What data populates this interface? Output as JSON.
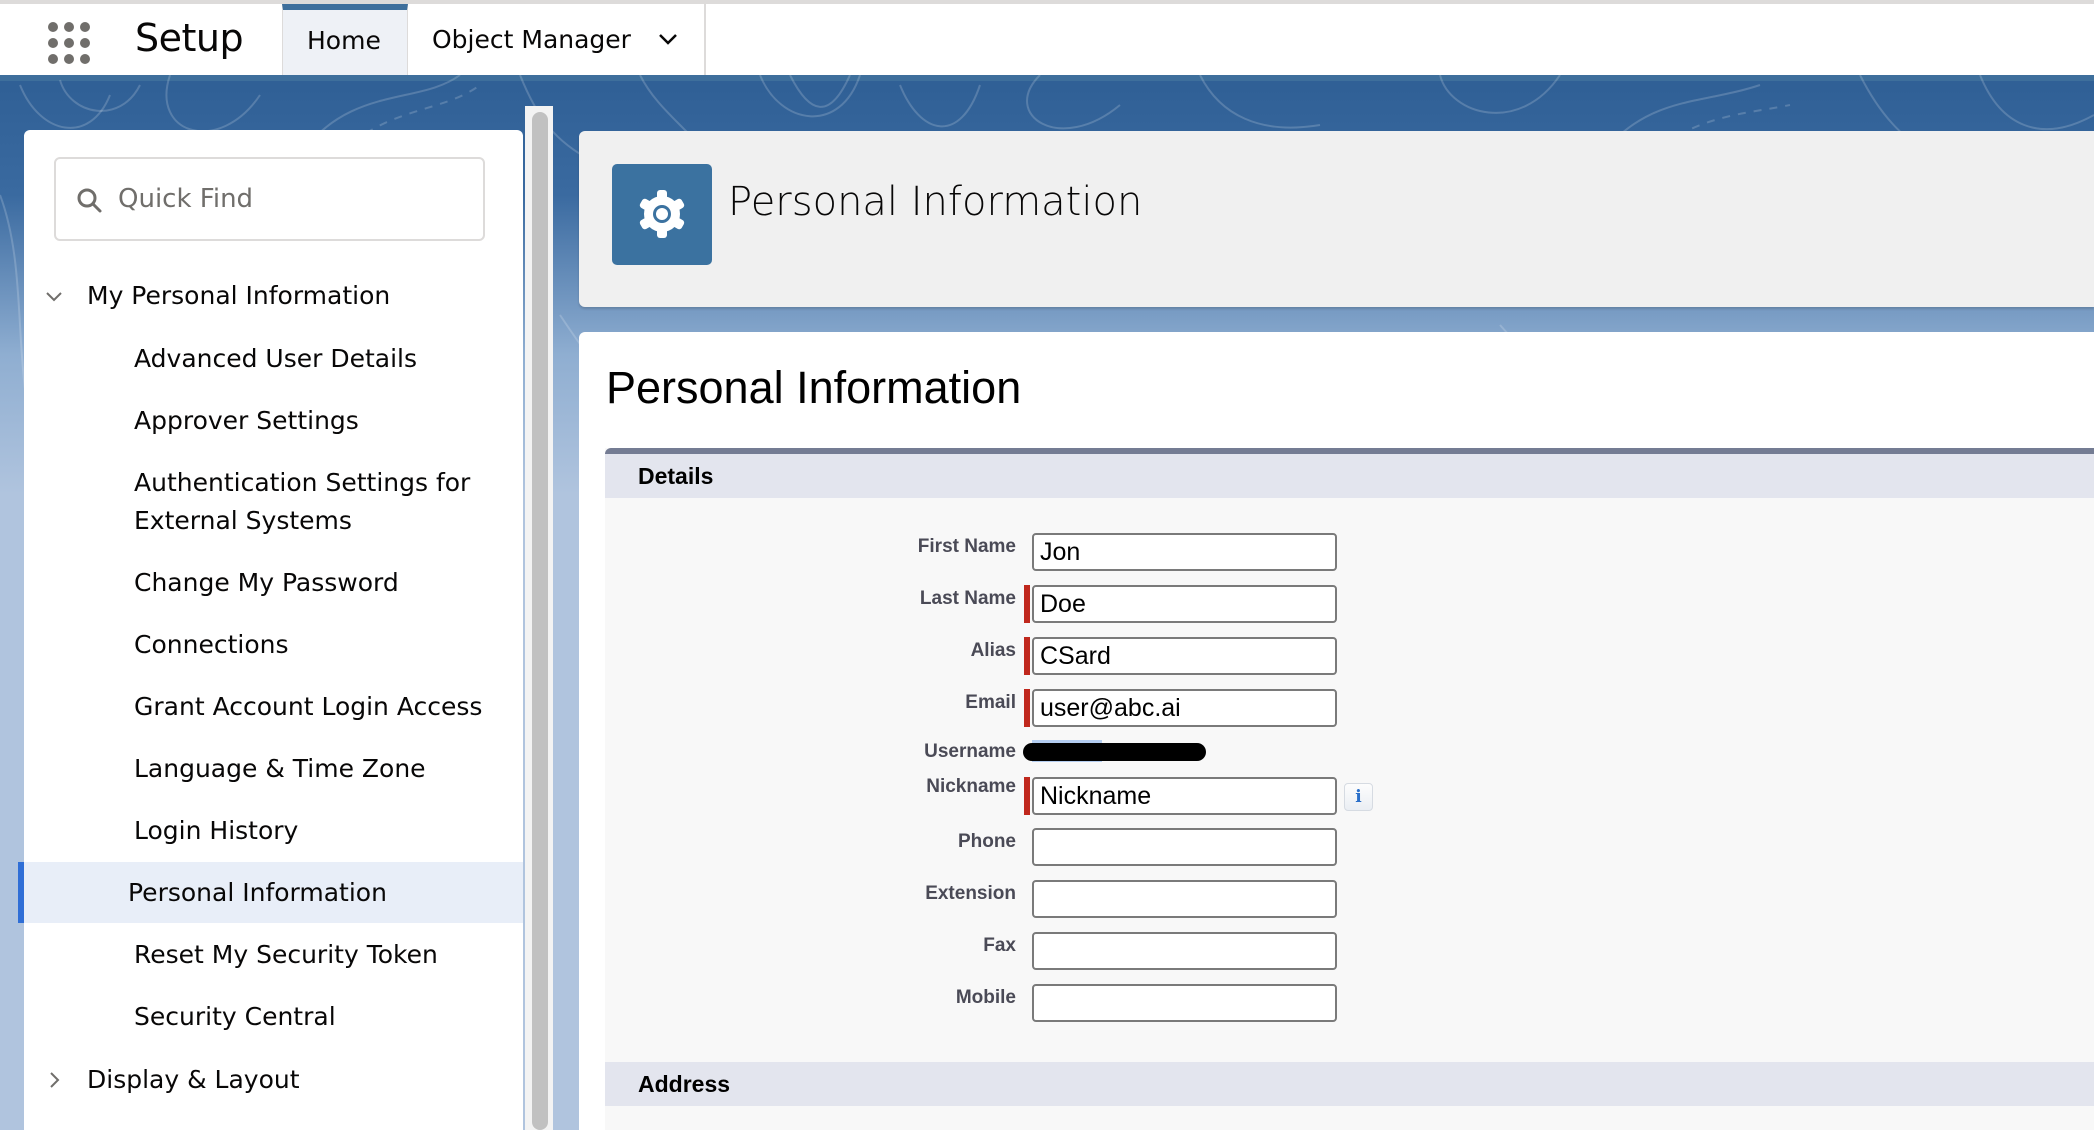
{
  "nav": {
    "app_launcher_icon": "waffle-grid-icon",
    "app_title": "Setup",
    "tabs": [
      {
        "label": "Home",
        "active": true
      },
      {
        "label": "Object Manager",
        "has_dropdown": true
      }
    ]
  },
  "sidebar": {
    "search": {
      "placeholder": "Quick Find",
      "value": "",
      "icon": "search-icon"
    },
    "groups": [
      {
        "label": "My Personal Information",
        "expanded": true,
        "items": [
          {
            "label": "Advanced User Details"
          },
          {
            "label": "Approver Settings"
          },
          {
            "label": "Authentication Settings for External Systems"
          },
          {
            "label": "Change My Password"
          },
          {
            "label": "Connections"
          },
          {
            "label": "Grant Account Login Access"
          },
          {
            "label": "Language & Time Zone"
          },
          {
            "label": "Login History"
          },
          {
            "label": "Personal Information",
            "active": true
          },
          {
            "label": "Reset My Security Token"
          },
          {
            "label": "Security Central"
          }
        ]
      },
      {
        "label": "Display & Layout",
        "expanded": false
      }
    ]
  },
  "header": {
    "icon": "gear-icon",
    "title": "Personal Information"
  },
  "main": {
    "page_title": "Personal Information",
    "sections": [
      {
        "title": "Details",
        "fields": [
          {
            "label": "First Name",
            "value": "Jon",
            "required": false,
            "type": "input"
          },
          {
            "label": "Last Name",
            "value": "Doe",
            "required": true,
            "type": "input"
          },
          {
            "label": "Alias",
            "value": "CSard",
            "required": true,
            "type": "input"
          },
          {
            "label": "Email",
            "value": "user@abc.ai",
            "required": true,
            "type": "input"
          },
          {
            "label": "Username",
            "value": "[redacted]",
            "type": "readonly"
          },
          {
            "label": "Nickname",
            "value": "Nickname",
            "required": true,
            "type": "input",
            "info_icon": "i"
          },
          {
            "label": "Phone",
            "value": "",
            "required": false,
            "type": "input"
          },
          {
            "label": "Extension",
            "value": "",
            "required": false,
            "type": "input"
          },
          {
            "label": "Fax",
            "value": "",
            "required": false,
            "type": "input"
          },
          {
            "label": "Mobile",
            "value": "",
            "required": false,
            "type": "input"
          }
        ]
      },
      {
        "title": "Address"
      }
    ]
  },
  "colors": {
    "brand_blue": "#3e6f9c",
    "active_item_bar": "#2f6ed6",
    "required_marker": "#c0281d",
    "section_header_bg": "#e3e5ee"
  }
}
